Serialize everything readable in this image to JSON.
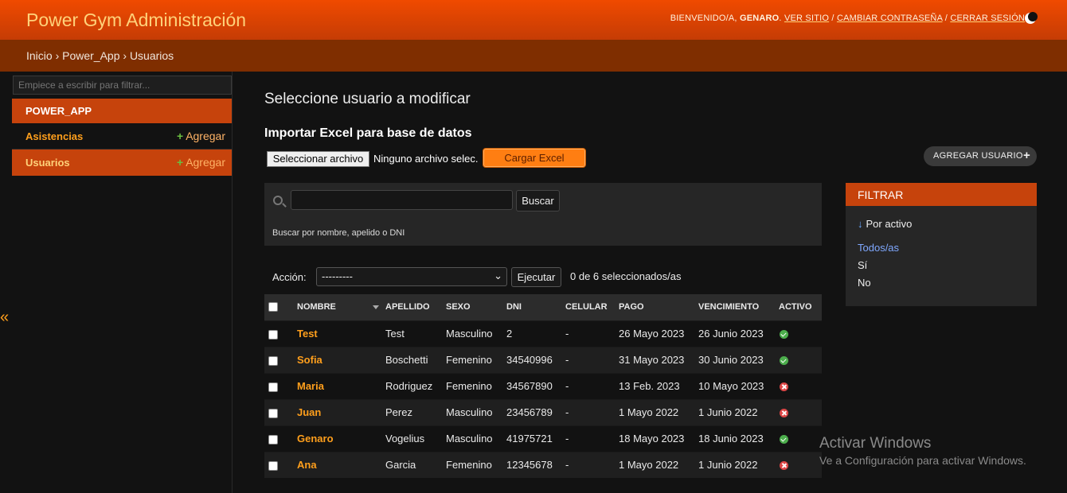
{
  "header": {
    "site_title": "Power Gym Administración",
    "welcome": "BIENVENIDO/A,",
    "username": "GENARO",
    "view_site": "VER SITIO",
    "change_password": "CAMBIAR CONTRASEÑA",
    "logout": "CERRAR SESIÓN",
    "separator": "/"
  },
  "breadcrumbs": {
    "text": "Inicio › Power_App › Usuarios"
  },
  "sidebar": {
    "filter_placeholder": "Empiece a escribir para filtrar...",
    "app_name": "POWER_APP",
    "models": [
      {
        "name": "Asistencias",
        "add_label": "Agregar"
      },
      {
        "name": "Usuarios",
        "add_label": "Agregar"
      }
    ],
    "collapse_glyph": "«"
  },
  "content": {
    "title": "Seleccione usuario a modificar",
    "import_title": "Importar Excel para base de datos",
    "file_button": "Seleccionar archivo",
    "file_status": "Ninguno archivo selec.",
    "upload_button": "Cargar Excel",
    "add_user_button": "AGREGAR USUARIO"
  },
  "search": {
    "value": "",
    "button": "Buscar",
    "help": "Buscar por nombre, apelido o DNI"
  },
  "actions": {
    "label": "Acción:",
    "selected_option": "---------",
    "go_button": "Ejecutar",
    "counter": "0 de 6 seleccionados/as"
  },
  "table": {
    "headers": [
      "NOMBRE",
      "APELLIDO",
      "SEXO",
      "DNI",
      "CELULAR",
      "PAGO",
      "VENCIMIENTO",
      "ACTIVO"
    ],
    "rows": [
      {
        "nombre": "Test",
        "apellido": "Test",
        "sexo": "Masculino",
        "dni": "2",
        "celular": "-",
        "pago": "26 Mayo 2023",
        "vencimiento": "26 Junio 2023",
        "activo": true
      },
      {
        "nombre": "Sofia",
        "apellido": "Boschetti",
        "sexo": "Femenino",
        "dni": "34540996",
        "celular": "-",
        "pago": "31 Mayo 2023",
        "vencimiento": "30 Junio 2023",
        "activo": true
      },
      {
        "nombre": "Maria",
        "apellido": "Rodriguez",
        "sexo": "Femenino",
        "dni": "34567890",
        "celular": "-",
        "pago": "13 Feb. 2023",
        "vencimiento": "10 Mayo 2023",
        "activo": false
      },
      {
        "nombre": "Juan",
        "apellido": "Perez",
        "sexo": "Masculino",
        "dni": "23456789",
        "celular": "-",
        "pago": "1 Mayo 2022",
        "vencimiento": "1 Junio 2022",
        "activo": false
      },
      {
        "nombre": "Genaro",
        "apellido": "Vogelius",
        "sexo": "Masculino",
        "dni": "41975721",
        "celular": "-",
        "pago": "18 Mayo 2023",
        "vencimiento": "18 Junio 2023",
        "activo": true
      },
      {
        "nombre": "Ana",
        "apellido": "Garcia",
        "sexo": "Femenino",
        "dni": "12345678",
        "celular": "-",
        "pago": "1 Mayo 2022",
        "vencimiento": "1 Junio 2022",
        "activo": false
      }
    ]
  },
  "filter": {
    "title": "FILTRAR",
    "heading_arrow": "↓",
    "heading": "Por activo",
    "choices": [
      "Todos/as",
      "Sí",
      "No"
    ]
  },
  "watermark": {
    "title": "Activar Windows",
    "subtitle": "Ve a Configuración para activar Windows."
  },
  "colors": {
    "header": "#e84a00",
    "accent": "#ff9f1c",
    "active": "#4cae4c",
    "inactive": "#dd4646"
  }
}
